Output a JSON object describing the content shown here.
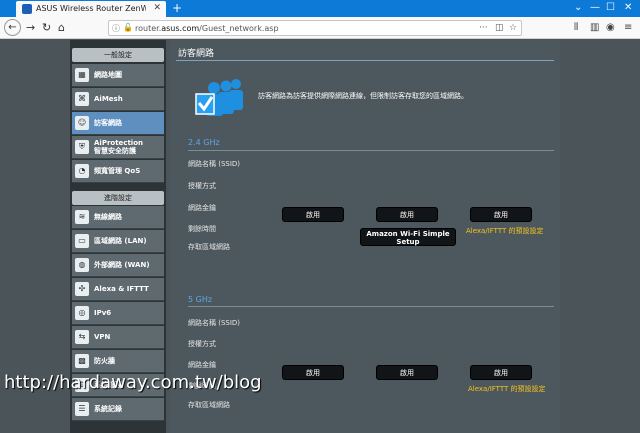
{
  "browser": {
    "tab_title": "ASUS Wireless Router ZenWi...",
    "url_prefix": "router.",
    "url_domain": "asus.com",
    "url_path": "/Guest_network.asp"
  },
  "sidebar": {
    "general_header": "一般設定",
    "general_items": [
      {
        "label": "網路地圖",
        "icon": "map-icon"
      },
      {
        "label": "AiMesh",
        "icon": "mesh-icon"
      },
      {
        "label": "訪客網路",
        "icon": "guest-icon",
        "active": true
      },
      {
        "label": "AiProtection\n智慧安全防護",
        "icon": "shield-icon"
      },
      {
        "label": "頻寬管理 QoS",
        "icon": "qos-icon"
      }
    ],
    "advanced_header": "進階設定",
    "advanced_items": [
      {
        "label": "無線網路",
        "icon": "wifi-icon"
      },
      {
        "label": "區域網路 (LAN)",
        "icon": "lan-icon"
      },
      {
        "label": "外部網路 (WAN)",
        "icon": "wan-icon"
      },
      {
        "label": "Alexa & IFTTT",
        "icon": "alexa-icon"
      },
      {
        "label": "IPv6",
        "icon": "ipv6-icon"
      },
      {
        "label": "VPN",
        "icon": "vpn-icon"
      },
      {
        "label": "防火牆",
        "icon": "firewall-icon"
      },
      {
        "label": "系統管理",
        "icon": "admin-icon"
      },
      {
        "label": "系統記錄",
        "icon": "log-icon"
      }
    ]
  },
  "main": {
    "title": "訪客網路",
    "intro": "訪客網路為訪客提供網際網路連線，但限制訪客存取您的區域網路。",
    "band1": {
      "label": "2.4 GHz",
      "rows": [
        "網路名稱 (SSID)",
        "授權方式",
        "網路金鑰",
        "剩餘時間",
        "存取區域網路"
      ],
      "enable_label": "啟用",
      "ws_label": "Amazon Wi-Fi Simple Setup",
      "alexa_label": "Alexa/IFTTT 的預設設定"
    },
    "band2": {
      "label": "5 GHz",
      "rows": [
        "網路名稱 (SSID)",
        "授權方式",
        "網路金鑰",
        "剩餘時間",
        "存取區域網路"
      ],
      "enable_label": "啟用",
      "alexa_label": "Alexa/IFTTT 的預設設定"
    }
  },
  "watermark": "http://hardaway.com.tw/blog"
}
